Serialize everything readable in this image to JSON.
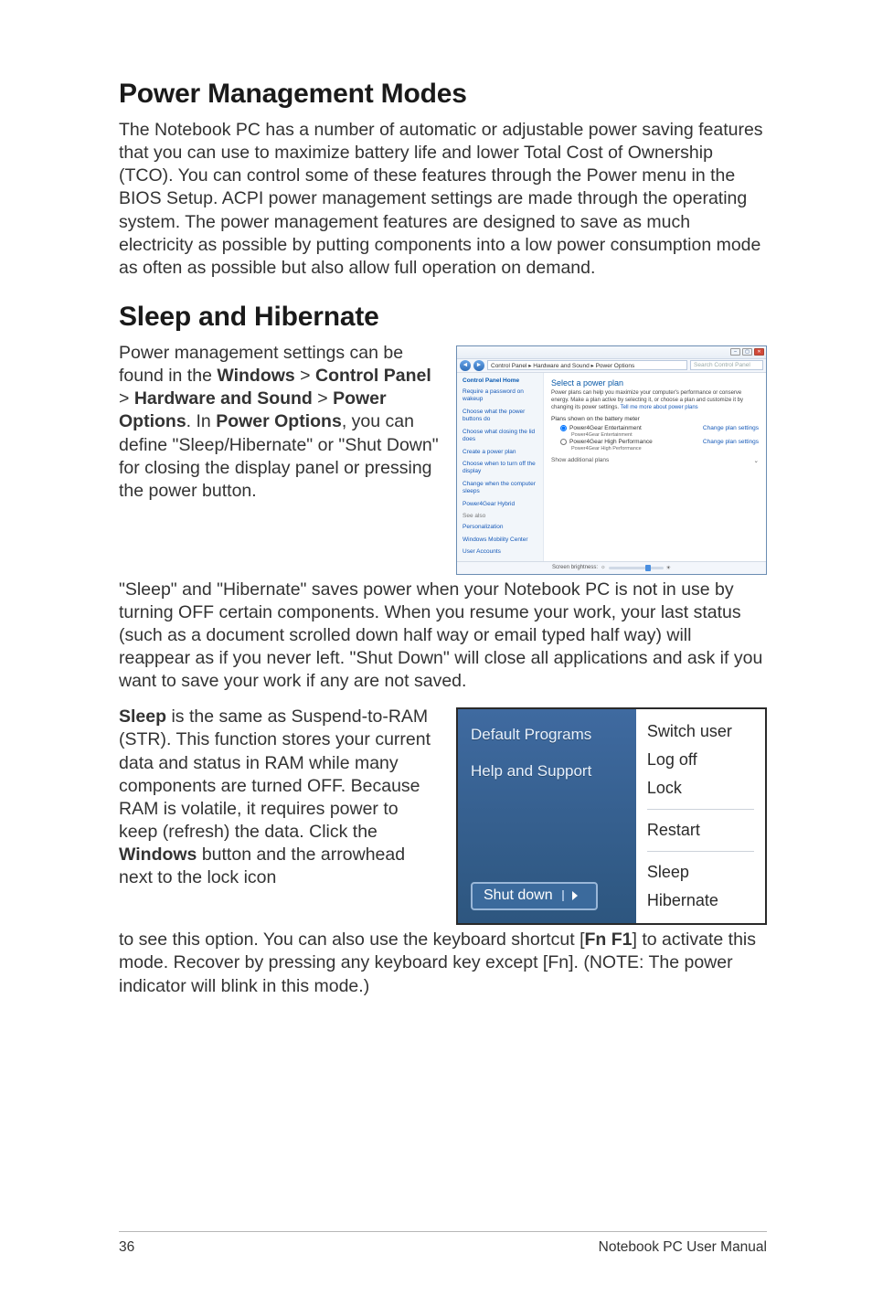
{
  "h1": "Power Management Modes",
  "intro": "The Notebook PC has a number of automatic or adjustable power saving features that you can use to maximize battery life and lower Total Cost of Ownership (TCO). You can control some of these features through the Power menu in the BIOS Setup. ACPI power management settings are made through the operating system. The power management features are designed to save as much electricity as possible by putting components into a low power consumption mode as often as possible but also allow full operation on demand.",
  "h2": "Sleep and Hibernate",
  "sleep_para_pre": "Power management settings can be found in the ",
  "sleep_bold1": "Windows",
  "sleep_gt1": " > ",
  "sleep_bold2": "Control Panel",
  "sleep_gt2": " > ",
  "sleep_bold3": "Hardware and Sound",
  "sleep_gt3": " > ",
  "sleep_bold4": "Power Options",
  "sleep_after_options": ". In ",
  "sleep_bold5": "Power Options",
  "sleep_tail": ", you can define \"Sleep/Hibernate\" or \"Shut Down\" for closing the display panel or pressing the power button.",
  "sleep_para_full": "\"Sleep\" and \"Hibernate\" saves power when your Notebook PC is not in use by turning OFF certain components. When you resume your work, your last status (such as a document scrolled down half way or email typed half way) will reappear as if you never left. \"Shut Down\" will close all applications and ask if you want to save your work if any are not saved.",
  "sleep2_bold": "Sleep",
  "sleep2_mid1": " is the same as Suspend-to-RAM (STR). This function stores your current data and status in RAM while many components are turned OFF. Because RAM is volatile, it requires power to keep (refresh) the data. Click the ",
  "sleep2_bold2": "Windows",
  "sleep2_mid2": " button and the arrowhead next to the lock icon",
  "sleep2_tail_pre": "to see this option. You can also use the keyboard shortcut [",
  "sleep2_bold3": "Fn F1",
  "sleep2_tail_post": "] to activate this mode. Recover by pressing any keyboard key except [Fn]. (NOTE: The power indicator will blink in this mode.)",
  "footer": {
    "page": "36",
    "manual": "Notebook PC User Manual"
  },
  "powerOptions": {
    "path": "Control Panel  ▸  Hardware and Sound  ▸  Power Options",
    "searchPlaceholder": "Search Control Panel",
    "cphome": "Control Panel Home",
    "links": {
      "l1": "Require a password on wakeup",
      "l2": "Choose what the power buttons do",
      "l3": "Choose what closing the lid does",
      "l4": "Create a power plan",
      "l5": "Choose when to turn off the display",
      "l6": "Change when the computer sleeps",
      "l7": "Power4Gear Hybrid"
    },
    "seeAlso": "See also",
    "see1": "Personalization",
    "see2": "Windows Mobility Center",
    "see3": "User Accounts",
    "mainHead": "Select a power plan",
    "mainDesc_pre": "Power plans can help you maximize your computer's performance or conserve energy. Make a plan active by selecting it, or choose a plan and customize it by changing its power settings. ",
    "mainDesc_link": "Tell me more about power plans",
    "grp": "Plans shown on the battery meter",
    "opt1": "Power4Gear Entertainment",
    "opt1s": "Power4Gear Entertainment",
    "opt2": "Power4Gear High Performance",
    "opt2s": "Power4Gear High Performance",
    "change": "Change plan settings",
    "showAdd": "Show additional plans",
    "brightnessLabel": "Screen brightness:"
  },
  "startMenu": {
    "left": {
      "defaultPrograms": "Default Programs",
      "helpSupport": "Help and Support",
      "shutDown": "Shut down"
    },
    "right": {
      "switchUser": "Switch user",
      "logOff": "Log off",
      "lock": "Lock",
      "restart": "Restart",
      "sleep": "Sleep",
      "hibernate": "Hibernate"
    }
  }
}
